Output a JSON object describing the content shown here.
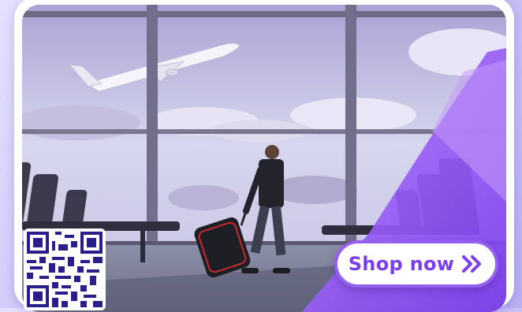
{
  "ad": {
    "cta_label": "Shop now",
    "cta_icon": "double-chevron-right-icon",
    "qr_icon": "qr-code-icon"
  },
  "colors": {
    "accent": "#8a4cf0",
    "accent_dark": "#7a3df0",
    "frame": "#ffffff",
    "page_bg": "#d4d0fa"
  }
}
